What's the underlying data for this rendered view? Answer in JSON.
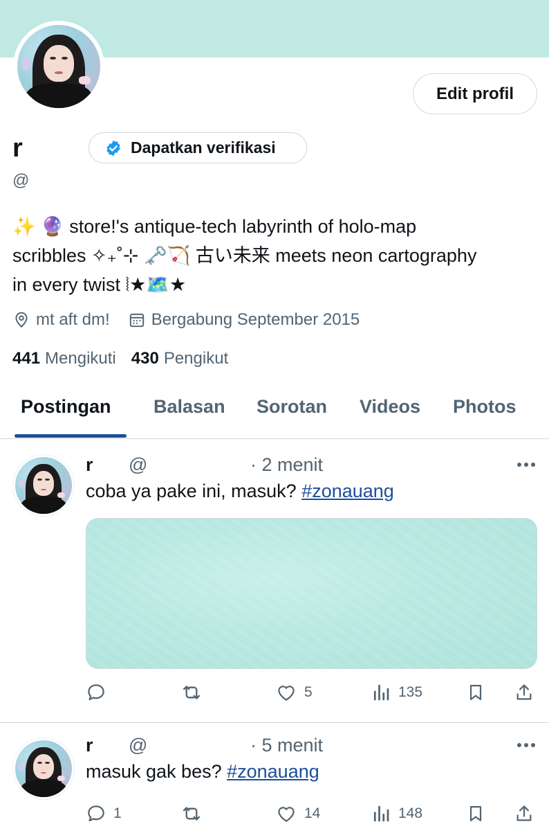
{
  "profile": {
    "name": "r",
    "handle": "@",
    "edit_label": "Edit profil",
    "verify_label": "Dapatkan verifikasi",
    "bio_lines": [
      "✨ 🔮 store!'s antique-tech labyrinth of holo-map",
      "scribbles ✧₊˚⊹ 🗝️🏹 古い未来 meets neon cartography",
      "in every twist ⦚★🗺️★"
    ],
    "location": "mt aft dm!",
    "joined": "Bergabung September 2015",
    "following_count": "441",
    "following_label": "Mengikuti",
    "followers_count": "430",
    "followers_label": "Pengikut"
  },
  "tabs": [
    {
      "label": "Postingan"
    },
    {
      "label": "Balasan"
    },
    {
      "label": "Sorotan"
    },
    {
      "label": "Videos"
    },
    {
      "label": "Photos"
    }
  ],
  "posts": [
    {
      "name": "r",
      "handle": "@",
      "time": "· 2 menit",
      "text": "coba ya pake ini, masuk? ",
      "hashtag": "#zonauang",
      "replies": "",
      "reposts": "",
      "likes": "5",
      "views": "135"
    },
    {
      "name": "r",
      "handle": "@",
      "time": "· 5 menit",
      "text": "masuk gak bes? ",
      "hashtag": "#zonauang",
      "replies": "1",
      "reposts": "",
      "likes": "14",
      "views": "148"
    }
  ],
  "colors": {
    "banner": "#bfe9e2",
    "accent": "#1d4e9a",
    "verified": "#1d9bf0",
    "muted": "#536471",
    "border": "#cfd9de"
  },
  "icons": [
    "verified-icon",
    "location-icon",
    "calendar-icon",
    "more-icon",
    "reply-icon",
    "repost-icon",
    "like-icon",
    "views-icon",
    "bookmark-icon",
    "share-icon"
  ]
}
